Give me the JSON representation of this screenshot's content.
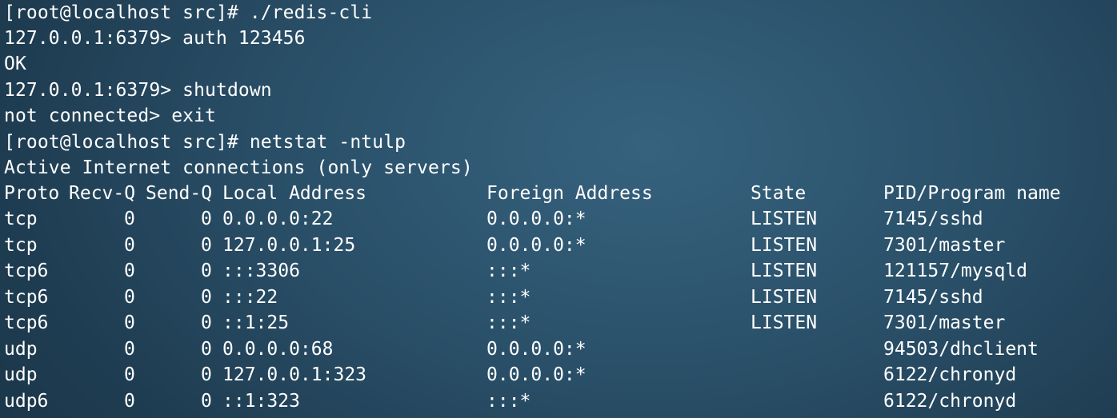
{
  "terminal": {
    "lines": [
      "[root@localhost src]# ./redis-cli",
      "127.0.0.1:6379> auth 123456",
      "OK",
      "127.0.0.1:6379> shutdown",
      "not connected> exit",
      "[root@localhost src]# netstat -ntulp",
      "Active Internet connections (only servers)"
    ],
    "table": {
      "headers": {
        "proto": "Proto",
        "recvq": "Recv-Q",
        "sendq": "Send-Q",
        "local": "Local Address",
        "foreign": "Foreign Address",
        "state": "State",
        "pid": "PID/Program name"
      },
      "rows": [
        {
          "proto": "tcp",
          "recvq": "0",
          "sendq": "0",
          "local": "0.0.0.0:22",
          "foreign": "0.0.0.0:*",
          "state": "LISTEN",
          "pid": "7145/sshd"
        },
        {
          "proto": "tcp",
          "recvq": "0",
          "sendq": "0",
          "local": "127.0.0.1:25",
          "foreign": "0.0.0.0:*",
          "state": "LISTEN",
          "pid": "7301/master"
        },
        {
          "proto": "tcp6",
          "recvq": "0",
          "sendq": "0",
          "local": ":::3306",
          "foreign": ":::*",
          "state": "LISTEN",
          "pid": "121157/mysqld"
        },
        {
          "proto": "tcp6",
          "recvq": "0",
          "sendq": "0",
          "local": ":::22",
          "foreign": ":::*",
          "state": "LISTEN",
          "pid": "7145/sshd"
        },
        {
          "proto": "tcp6",
          "recvq": "0",
          "sendq": "0",
          "local": "::1:25",
          "foreign": ":::*",
          "state": "LISTEN",
          "pid": "7301/master"
        },
        {
          "proto": "udp",
          "recvq": "0",
          "sendq": "0",
          "local": "0.0.0.0:68",
          "foreign": "0.0.0.0:*",
          "state": "",
          "pid": "94503/dhclient"
        },
        {
          "proto": "udp",
          "recvq": "0",
          "sendq": "0",
          "local": "127.0.0.1:323",
          "foreign": "0.0.0.0:*",
          "state": "",
          "pid": "6122/chronyd"
        },
        {
          "proto": "udp6",
          "recvq": "0",
          "sendq": "0",
          "local": "::1:323",
          "foreign": ":::*",
          "state": "",
          "pid": "6122/chronyd"
        }
      ]
    }
  }
}
